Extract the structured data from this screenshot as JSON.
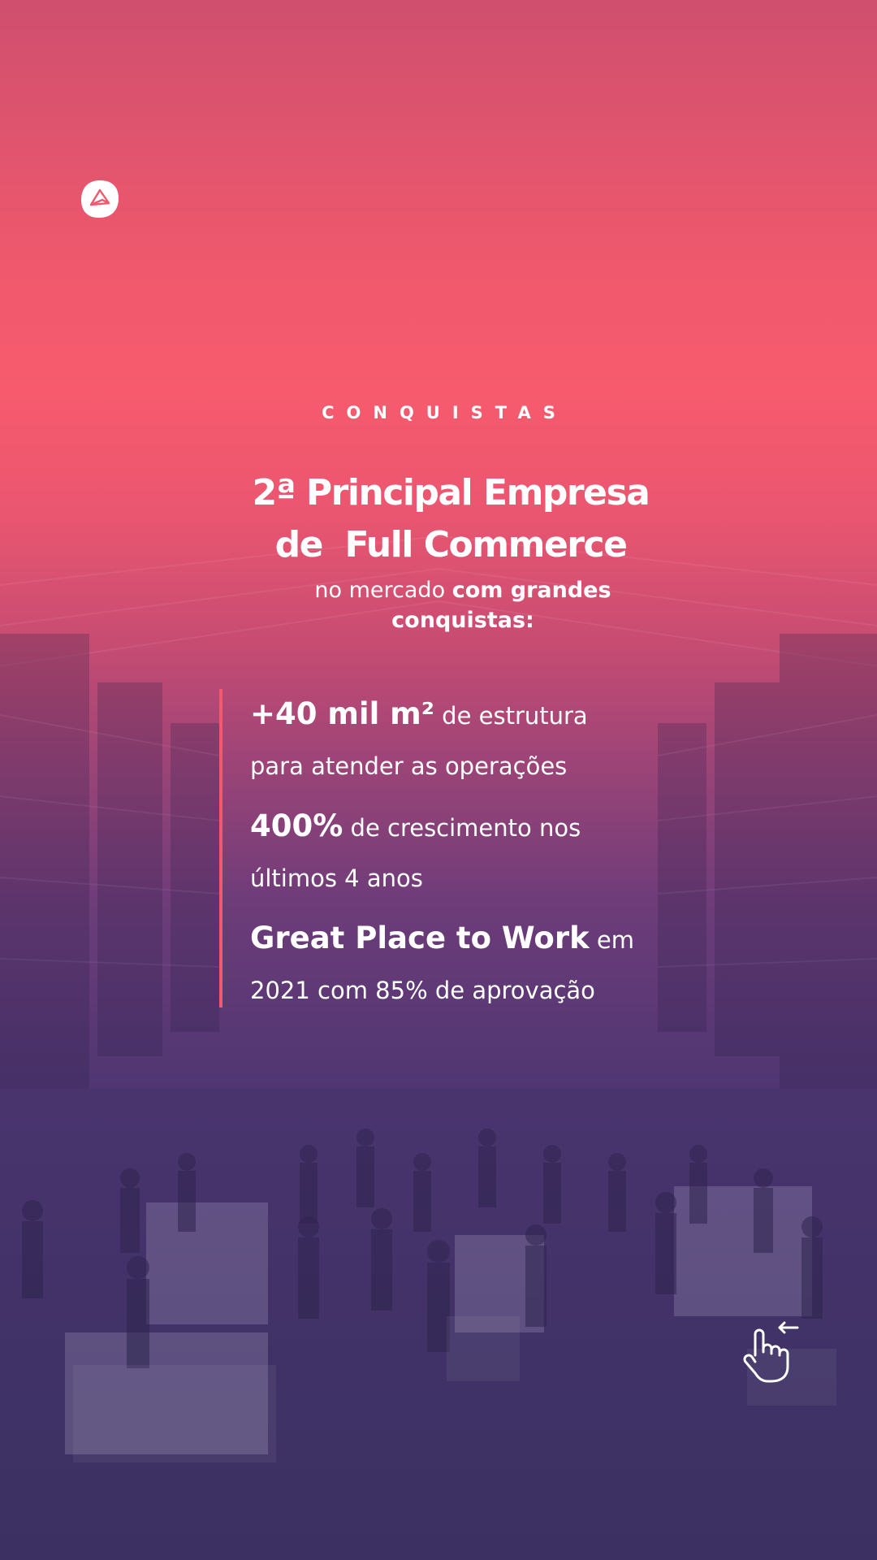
{
  "eyebrow": "CONQUISTAS",
  "headline": {
    "line1": "2ª Principal Empresa",
    "line2": "de  Full Commerce"
  },
  "subline": {
    "part1": "no mercado",
    "part2": "com grandes",
    "line2": "conquistas:"
  },
  "stats": [
    {
      "highlight": "+40 mil m²",
      "rest": "de estrutura",
      "line2": "para atender as operações"
    },
    {
      "highlight": "400%",
      "rest": "de crescimento nos",
      "line2": "últimos 4 anos"
    },
    {
      "highlight": "Great Place to Work",
      "rest": "em",
      "line2": "2021 com 85% de aprovação"
    }
  ],
  "icons": {
    "logo": "brand-logo-icon",
    "swipe": "swipe-left-hand-icon"
  },
  "colors": {
    "accent": "#f15a6d",
    "gradient_top": "#f75a6d",
    "gradient_bottom": "#3d3163",
    "text": "#ffffff"
  }
}
